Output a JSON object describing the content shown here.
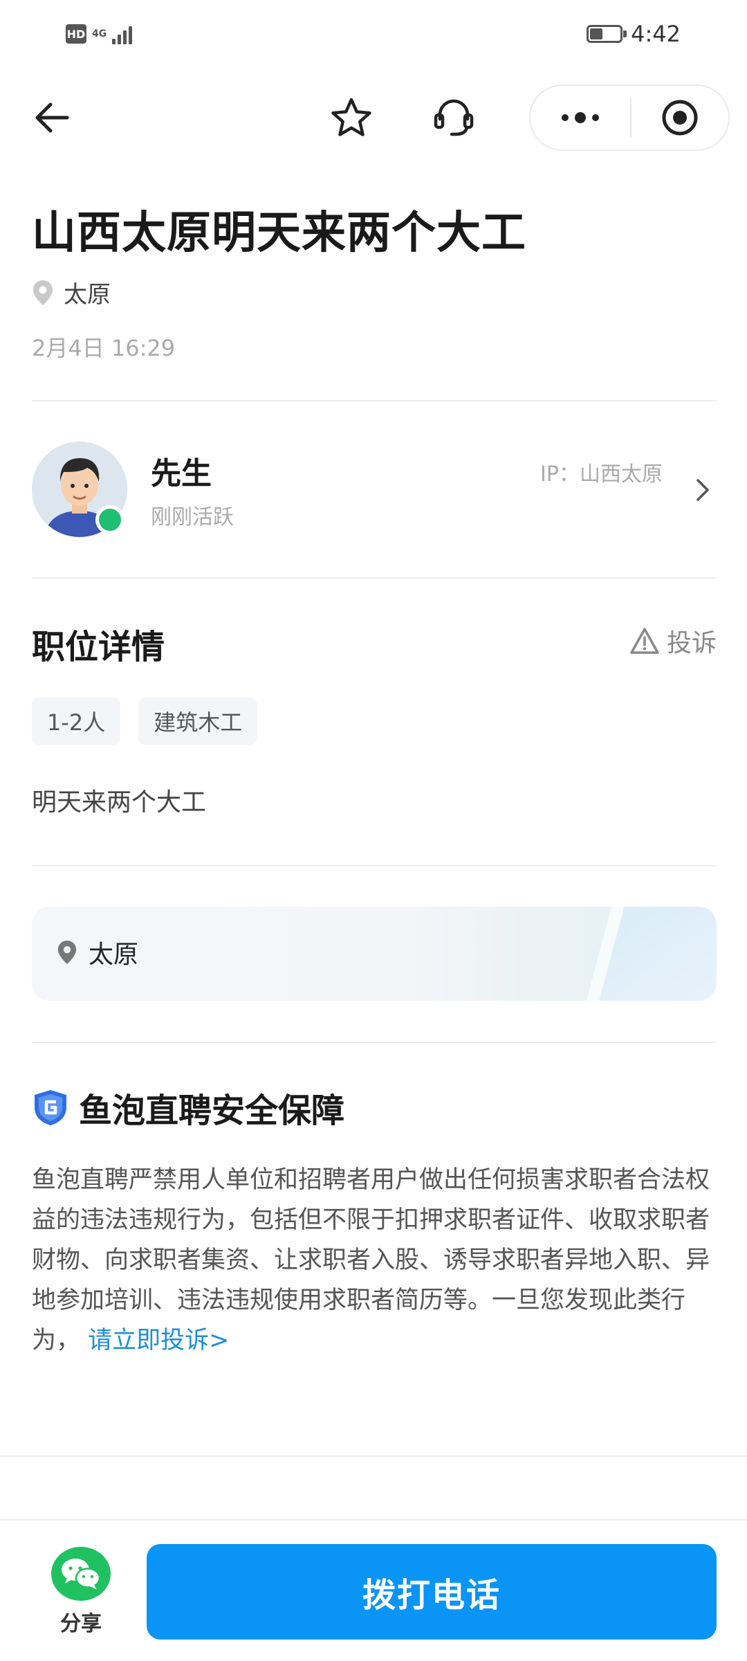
{
  "status_bar": {
    "hd": "HD",
    "network": "4G",
    "time": "4:42",
    "battery_level": 0.4
  },
  "nav": {
    "back_icon": "arrow-left-icon",
    "favorite_icon": "star-icon",
    "service_icon": "headset-icon",
    "more_icon": "more-dots-icon",
    "close_icon": "target-icon"
  },
  "job": {
    "title": "山西太原明天来两个大工",
    "location": "太原",
    "date": "2月4日 16:29"
  },
  "poster": {
    "name": "先生",
    "activity": "刚刚活跃",
    "ip": "IP：山西太原",
    "online_color": "#1fbf73"
  },
  "details": {
    "section_title": "职位详情",
    "complain_label": "投诉",
    "tags": [
      "1-2人",
      "建筑木工"
    ],
    "description": "明天来两个大工"
  },
  "map": {
    "location": "太原"
  },
  "safety": {
    "title": "鱼泡直聘安全保障",
    "body": "鱼泡直聘严禁用人单位和招聘者用户做出任何损害求职者合法权益的违法违规行为，包括但不限于扣押求职者证件、收取求职者财物、向求职者集资、让求职者入股、诱导求职者异地入职、异地参加培训、违法违规使用求职者简历等。一旦您发现此类行为，",
    "link": "请立即投诉>",
    "link_color": "#1b8fd6"
  },
  "bottom": {
    "share_label": "分享",
    "call_label": "拨打电话",
    "accent_color": "#0a94f5"
  }
}
